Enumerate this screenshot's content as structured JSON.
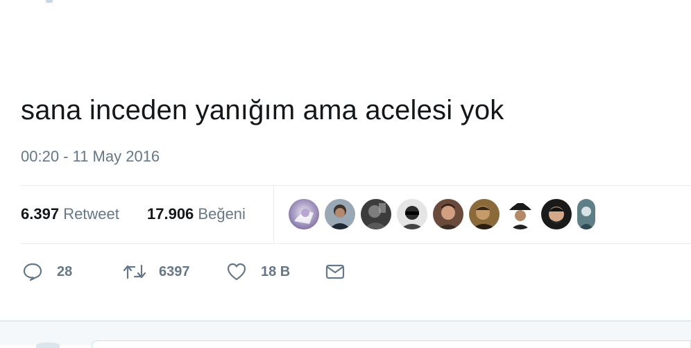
{
  "tweet": {
    "text": "sana inceden yanığım ama acelesi yok",
    "timestamp": "00:20 - 11 May 2016"
  },
  "stats": {
    "retweets": {
      "count": "6.397",
      "label": "Retweet"
    },
    "likes": {
      "count": "17.906",
      "label": "Beğeni"
    }
  },
  "likers": [
    {
      "name": "liker-avatar-1"
    },
    {
      "name": "liker-avatar-2"
    },
    {
      "name": "liker-avatar-3"
    },
    {
      "name": "liker-avatar-4"
    },
    {
      "name": "liker-avatar-5"
    },
    {
      "name": "liker-avatar-6"
    },
    {
      "name": "liker-avatar-7"
    },
    {
      "name": "liker-avatar-8"
    },
    {
      "name": "liker-avatar-9"
    }
  ],
  "actions": {
    "reply": {
      "icon": "reply-icon",
      "count": "28"
    },
    "retweet": {
      "icon": "retweet-icon",
      "count": "6397"
    },
    "like": {
      "icon": "heart-icon",
      "count": "18 B"
    },
    "dm": {
      "icon": "envelope-icon"
    }
  },
  "colors": {
    "text": "#14171a",
    "secondary": "#657786",
    "divider": "#e6ecf0"
  }
}
